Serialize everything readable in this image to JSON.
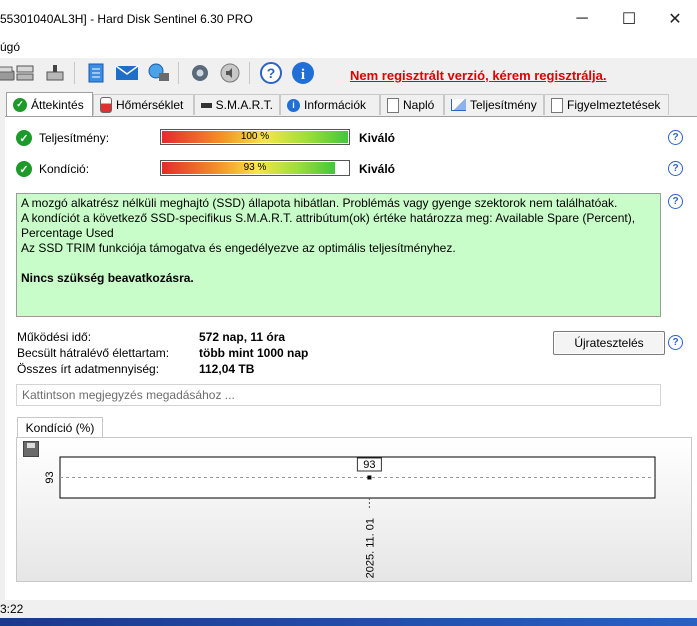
{
  "window": {
    "title": "55301040AL3H]  -  Hard Disk Sentinel 6.30 PRO",
    "controls": [
      "─",
      "☐",
      "✕"
    ]
  },
  "menu": {
    "items": [
      "úgó"
    ]
  },
  "toolbar": {
    "register_text": "Nem regisztrált verzió, kérem regisztrálja.",
    "icons": [
      "disk-icon",
      "disk-multi-icon",
      "disk-down-icon",
      "report-icon",
      "mail-icon",
      "network-icon",
      "settings-icon",
      "sound-icon",
      "help-icon",
      "info-icon"
    ]
  },
  "tabs": [
    {
      "label": "Áttekintés",
      "icon": "check-icon",
      "active": true
    },
    {
      "label": "Hőmérséklet",
      "icon": "thermometer-icon"
    },
    {
      "label": "S.M.A.R.T.",
      "icon": "smart-icon"
    },
    {
      "label": "Információk",
      "icon": "info-icon"
    },
    {
      "label": "Napló",
      "icon": "log-icon"
    },
    {
      "label": "Teljesítmény",
      "icon": "chart-icon"
    },
    {
      "label": "Figyelmeztetések",
      "icon": "alerts-icon"
    }
  ],
  "overview": {
    "performance": {
      "label": "Teljesítmény:",
      "value_text": "100 %",
      "percent": 100,
      "status": "Kiváló"
    },
    "condition": {
      "label": "Kondíció:",
      "value_text": "93 %",
      "percent": 93,
      "status": "Kiváló"
    },
    "message": {
      "line1": "A mozgó alkatrész nélküli meghajtó (SSD) állapota hibátlan. Problémás vagy gyenge szektorok nem találhatóak.",
      "line2": "A kondíciót a következő SSD-specifikus S.M.A.R.T. attribútum(ok) értéke határozza meg:  Available Spare (Percent), Percentage Used",
      "line3": "Az SSD TRIM funkciója támogatva és engedélyezve az optimális teljesítményhez.",
      "line4": "Nincs szükség beavatkozásra."
    },
    "stats": [
      {
        "label": "Működési idő:",
        "value": "572 nap, 11 óra"
      },
      {
        "label": "Becsült hátralévő élettartam:",
        "value": "több mint 1000 nap"
      },
      {
        "label": "Összes írt adatmennyiség:",
        "value": "112,04 TB"
      }
    ],
    "retest_label": "Újratesztelés",
    "note_placeholder": "Kattintson megjegyzés megadásához ..."
  },
  "chart_tab_label": "Kondíció  (%)",
  "chart_data": {
    "type": "line",
    "x": [
      "2025. 11. 01"
    ],
    "series": [
      {
        "values": [
          93
        ]
      }
    ],
    "y_tick_labels": [
      "93"
    ],
    "data_labels": [
      "93"
    ],
    "grid": true
  },
  "statusbar": {
    "time": "3:22"
  }
}
